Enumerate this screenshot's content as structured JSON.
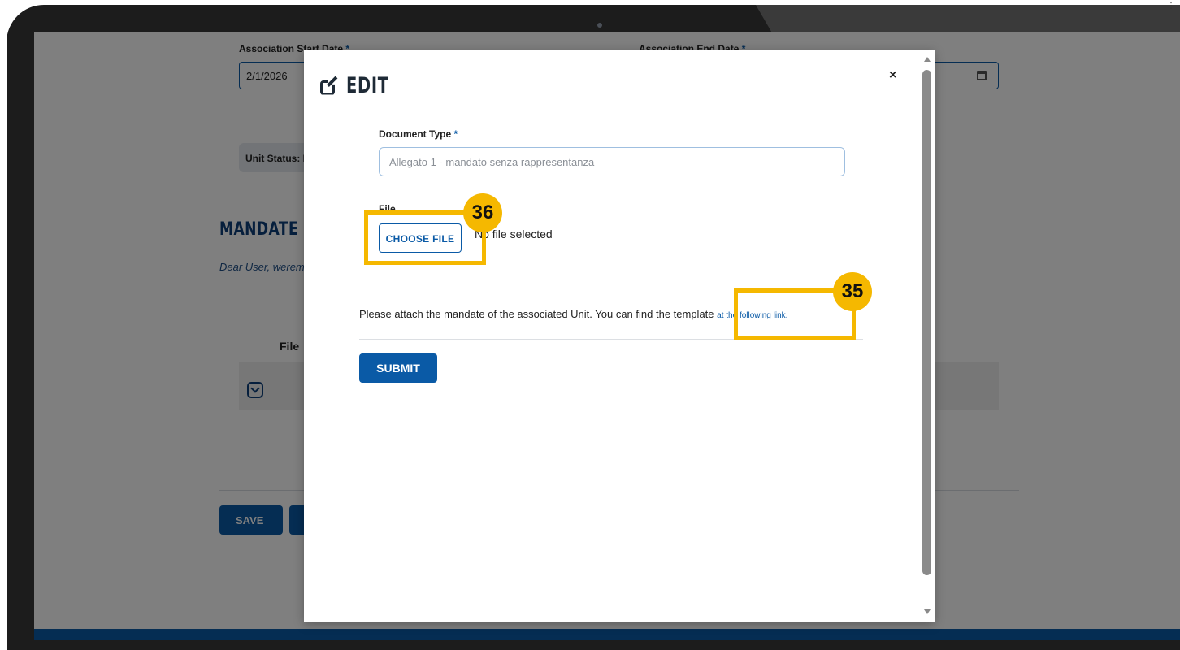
{
  "background_page": {
    "start_date_label": "Association Start Date",
    "start_date_value": "2/1/2026",
    "end_date_label": "Association End Date",
    "required_marker": "*",
    "unit_status_label": "Unit Status: E",
    "mandate_title": "MANDATE",
    "dear_user_text": "Dear User, werem",
    "file_column_header": "File",
    "save_label": "SAVE"
  },
  "modal": {
    "title": "EDIT",
    "close_symbol": "×",
    "document_type_label": "Document Type",
    "required_marker": "*",
    "document_type_value": "Allegato 1 - mandato senza rappresentanza",
    "file_label": "File",
    "choose_file_label": "CHOOSE FILE",
    "no_file_text": "No file selected",
    "attach_text": "Please attach the mandate of the associated Unit. You can find the template",
    "attach_link_text": "at the following link",
    "attach_link_suffix": ".",
    "submit_label": "SUBMIT"
  },
  "annotations": [
    {
      "number": "36",
      "target": "choose-file-button"
    },
    {
      "number": "35",
      "target": "template-link"
    }
  ],
  "colors": {
    "primary": "#0a5aa6",
    "annotation": "#f5b800",
    "overlay": "rgba(0,0,0,0.5)"
  }
}
